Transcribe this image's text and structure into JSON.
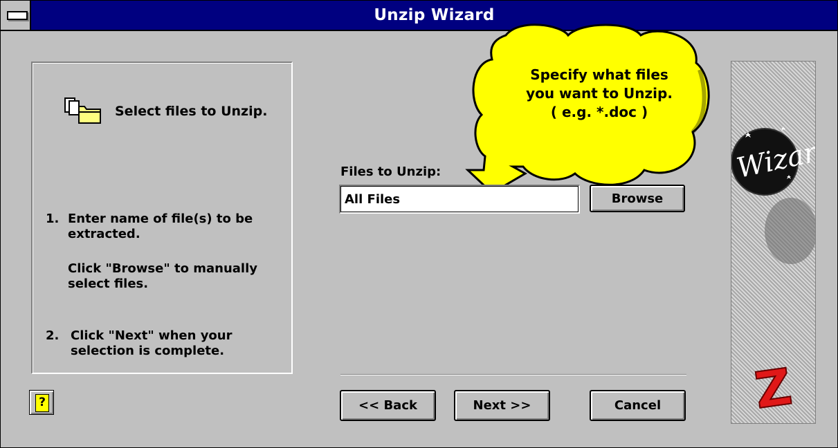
{
  "window": {
    "title": "Unzip Wizard"
  },
  "left_panel": {
    "step_title": "Select files to Unzip.",
    "step1_number": "1.",
    "step1_line1": "Enter name of file(s) to be",
    "step1_line2": "extracted.",
    "step1_browse_line1": "Click \"Browse\" to manually",
    "step1_browse_line2": "select files.",
    "step2_number": "2.",
    "step2_line1": "Click \"Next\" when your",
    "step2_line2": "selection is complete."
  },
  "help": {
    "label": "?"
  },
  "form": {
    "files_label": "Files to Unzip:",
    "files_value": "All Files",
    "browse_label": "Browse"
  },
  "callout": {
    "line1": "Specify what files",
    "line2": "you want to Unzip.",
    "line3": "( e.g.  *.doc )"
  },
  "buttons": {
    "back_label": "<< Back",
    "next_label": "Next >>",
    "cancel_label": "Cancel"
  },
  "banner": {
    "logo_text": "Wizard",
    "logo_letter": "Z"
  },
  "colors": {
    "titlebar": "#000080",
    "face": "#c0c0c0",
    "callout": "#ffff00"
  }
}
